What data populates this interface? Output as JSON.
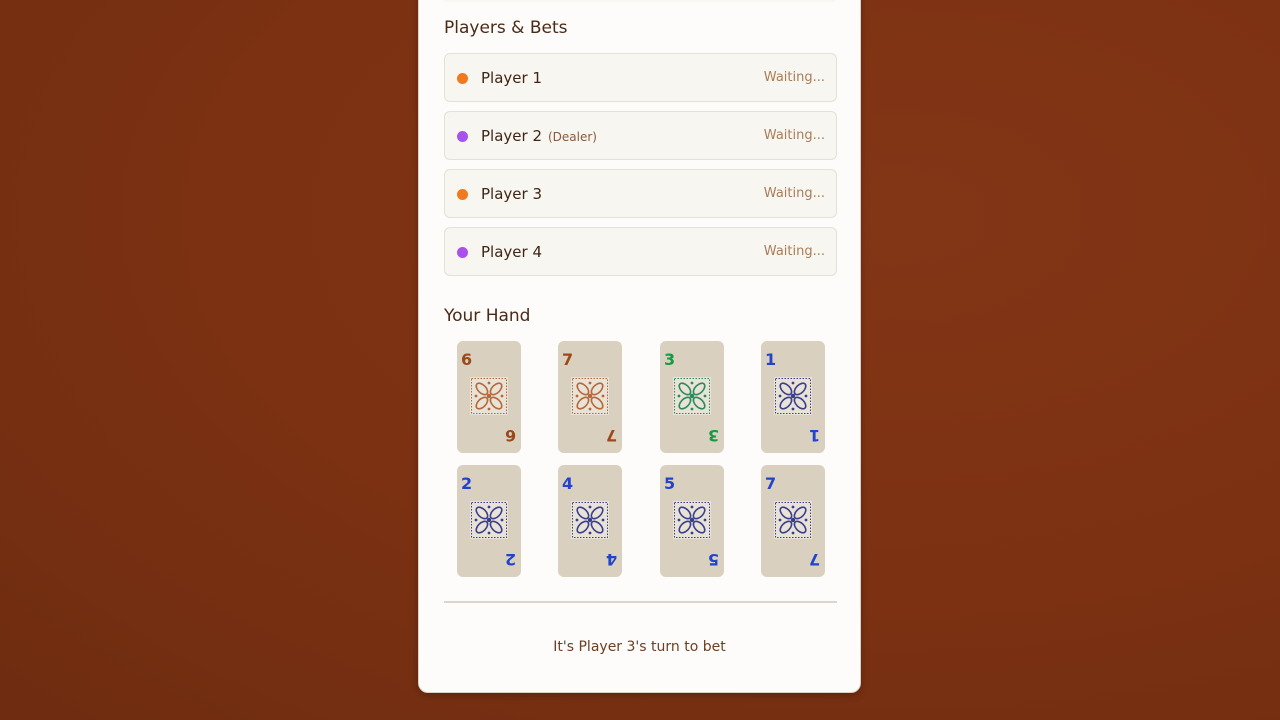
{
  "players_section": {
    "title": "Players & Bets",
    "players": [
      {
        "name": "Player 1",
        "dealer_tag": "",
        "status": "Waiting...",
        "color": "#f07a1d"
      },
      {
        "name": "Player 2",
        "dealer_tag": "(Dealer)",
        "status": "Waiting...",
        "color": "#a752ec"
      },
      {
        "name": "Player 3",
        "dealer_tag": "",
        "status": "Waiting...",
        "color": "#f07a1d"
      },
      {
        "name": "Player 4",
        "dealer_tag": "",
        "status": "Waiting...",
        "color": "#a752ec"
      }
    ]
  },
  "hand_section": {
    "title": "Your Hand",
    "cards": [
      {
        "value": "6",
        "color": "#9a4a1a",
        "tile_color": "#b5683a"
      },
      {
        "value": "7",
        "color": "#9a4a1a",
        "tile_color": "#b5683a"
      },
      {
        "value": "3",
        "color": "#169a45",
        "tile_color": "#2a8a5a"
      },
      {
        "value": "1",
        "color": "#2244cc",
        "tile_color": "#3a3f8c"
      },
      {
        "value": "2",
        "color": "#2244cc",
        "tile_color": "#3a3f8c"
      },
      {
        "value": "4",
        "color": "#2244cc",
        "tile_color": "#3a3f8c"
      },
      {
        "value": "5",
        "color": "#2244cc",
        "tile_color": "#3a3f8c"
      },
      {
        "value": "7",
        "color": "#2244cc",
        "tile_color": "#3a3f8c"
      }
    ]
  },
  "status": {
    "turn_text": "It's Player 3's turn to bet"
  }
}
